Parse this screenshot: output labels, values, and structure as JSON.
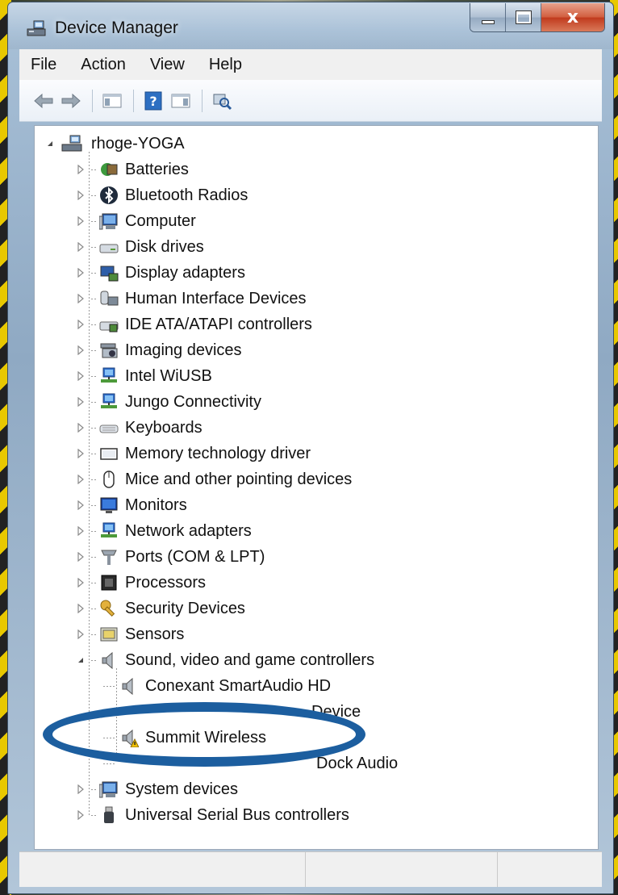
{
  "window": {
    "title": "Device Manager",
    "title_icon": "device-manager-icon",
    "caption_buttons": [
      "minimize",
      "maximize",
      "close"
    ],
    "close_glyph": "x"
  },
  "menu": {
    "items": [
      "File",
      "Action",
      "View",
      "Help"
    ]
  },
  "toolbar": {
    "buttons": [
      "back-arrow-icon",
      "forward-arrow-icon",
      "show-hide-console-tree-icon",
      "help-icon",
      "show-hide-action-pane-icon",
      "scan-hardware-changes-icon"
    ]
  },
  "tree": {
    "root": {
      "label": "rhoge-YOGA",
      "icon": "computer-network-icon",
      "expanded": true
    },
    "categories": [
      {
        "label": "Batteries",
        "icon": "battery-icon"
      },
      {
        "label": "Bluetooth Radios",
        "icon": "bluetooth-icon"
      },
      {
        "label": "Computer",
        "icon": "computer-icon"
      },
      {
        "label": "Disk drives",
        "icon": "disk-drive-icon"
      },
      {
        "label": "Display adapters",
        "icon": "display-adapter-icon"
      },
      {
        "label": "Human Interface Devices",
        "icon": "hid-icon"
      },
      {
        "label": "IDE ATA/ATAPI controllers",
        "icon": "ide-controller-icon"
      },
      {
        "label": "Imaging devices",
        "icon": "imaging-device-icon"
      },
      {
        "label": "Intel WiUSB",
        "icon": "network-icon"
      },
      {
        "label": "Jungo Connectivity",
        "icon": "network-icon"
      },
      {
        "label": "Keyboards",
        "icon": "keyboard-icon"
      },
      {
        "label": "Memory technology driver",
        "icon": "memory-icon"
      },
      {
        "label": "Mice and other pointing devices",
        "icon": "mouse-icon"
      },
      {
        "label": "Monitors",
        "icon": "monitor-icon"
      },
      {
        "label": "Network adapters",
        "icon": "network-adapter-icon"
      },
      {
        "label": "Ports (COM & LPT)",
        "icon": "port-icon"
      },
      {
        "label": "Processors",
        "icon": "processor-icon"
      },
      {
        "label": "Security Devices",
        "icon": "key-icon"
      },
      {
        "label": "Sensors",
        "icon": "sensor-icon"
      },
      {
        "label": "Sound, video and game controllers",
        "icon": "speaker-icon",
        "expanded": true
      }
    ],
    "sound_children": [
      {
        "label": "Conexant SmartAudio HD",
        "icon": "speaker-icon",
        "warning": false
      },
      {
        "label": "Device",
        "icon": "speaker-icon",
        "warning": false,
        "partially_obscured": true
      },
      {
        "label": "Summit  Wireless",
        "icon": "speaker-warning-icon",
        "warning": true
      },
      {
        "label": "Dock Audio",
        "icon": "speaker-icon",
        "warning": false,
        "partially_obscured": true
      }
    ],
    "after_categories": [
      {
        "label": "System devices",
        "icon": "computer-icon"
      },
      {
        "label": "Universal Serial Bus controllers",
        "icon": "usb-icon"
      }
    ]
  },
  "colors": {
    "highlight_ellipse": "#1c5e9f",
    "warning": "#f2c200"
  }
}
